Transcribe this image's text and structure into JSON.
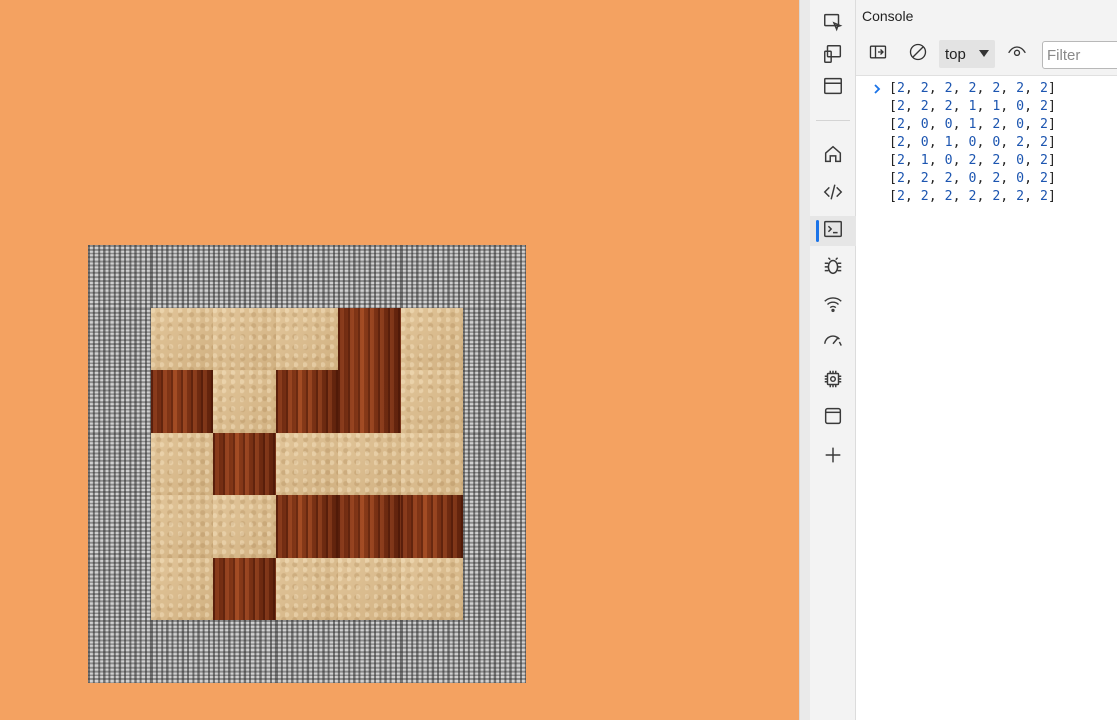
{
  "board": {
    "grid": [
      [
        2,
        2,
        2,
        2,
        2,
        2,
        2
      ],
      [
        2,
        2,
        2,
        1,
        1,
        0,
        2
      ],
      [
        2,
        0,
        0,
        1,
        2,
        0,
        2
      ],
      [
        2,
        0,
        1,
        0,
        0,
        2,
        2
      ],
      [
        2,
        1,
        0,
        2,
        2,
        0,
        2
      ],
      [
        2,
        2,
        2,
        0,
        2,
        0,
        2
      ],
      [
        2,
        2,
        2,
        2,
        2,
        2,
        2
      ]
    ],
    "displayed_layout": [
      [
        "metal",
        "metal",
        "metal",
        "metal",
        "metal",
        "metal",
        "metal"
      ],
      [
        "metal",
        "sand",
        "sand",
        "sand",
        "wood",
        "sand",
        "metal"
      ],
      [
        "metal",
        "wood",
        "sand",
        "wood",
        "wood",
        "sand",
        "metal"
      ],
      [
        "metal",
        "sand",
        "wood",
        "sand",
        "sand",
        "sand",
        "metal"
      ],
      [
        "metal",
        "sand",
        "sand",
        "wood",
        "wood",
        "wood",
        "metal"
      ],
      [
        "metal",
        "sand",
        "wood",
        "sand",
        "sand",
        "sand",
        "metal"
      ],
      [
        "metal",
        "metal",
        "metal",
        "metal",
        "metal",
        "metal",
        "metal"
      ]
    ]
  },
  "devtools": {
    "panel_title": "Console",
    "context_label": "top",
    "filter_placeholder": "Filter",
    "activity_icons": [
      "inspect-icon",
      "device-emulation-icon",
      "dock-icon",
      "home-icon",
      "elements-icon",
      "console-icon",
      "sources-icon",
      "network-icon",
      "performance-icon",
      "memory-icon",
      "application-icon",
      "add-tool-icon"
    ],
    "toolbar_icons": [
      "sidebar-toggle-icon",
      "clear-console-icon",
      "eye-icon"
    ],
    "console_lines": [
      "[2, 2, 2, 2, 2, 2, 2]",
      "[2, 2, 2, 1, 1, 0, 2]",
      "[2, 0, 0, 1, 2, 0, 2]",
      "[2, 0, 1, 0, 0, 2, 2]",
      "[2, 1, 0, 2, 2, 0, 2]",
      "[2, 2, 2, 0, 2, 0, 2]",
      "[2, 2, 2, 2, 2, 2, 2]"
    ],
    "accent_color": "#1a73e8"
  },
  "page": {
    "background_color": "#f4a261"
  }
}
